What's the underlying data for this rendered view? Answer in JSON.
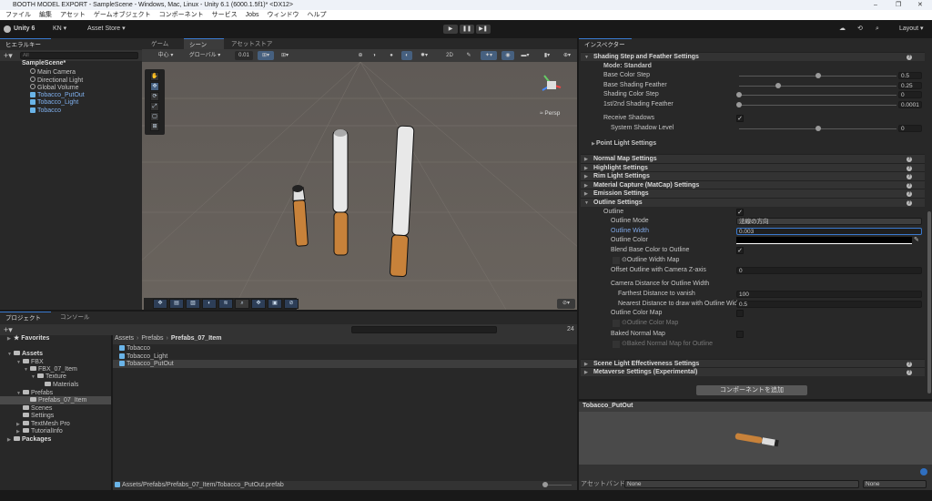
{
  "window": {
    "title": "BOOTH MODEL EXPORT - SampleScene - Windows, Mac, Linux - Unity 6.1 (6000.1.5f1)* <DX12>",
    "minimize": "–",
    "maximize": "❐",
    "close": "✕"
  },
  "menu": [
    "ファイル",
    "編集",
    "アセット",
    "ゲームオブジェクト",
    "コンポーネント",
    "サービス",
    "Jobs",
    "ウィンドウ",
    "ヘルプ"
  ],
  "toolbar": {
    "unity": "Unity 6",
    "account": "KN ▾",
    "asset_store": "Asset Store ▾",
    "play": "▶",
    "pause": "❚❚",
    "step": "▶❚",
    "layout": "Layout ▾"
  },
  "hierarchy": {
    "tab": "ヒエラルキー",
    "search_placeholder": "All",
    "scene": "SampleScene*",
    "items": [
      {
        "label": "Main Camera",
        "prefab": false
      },
      {
        "label": "Directional Light",
        "prefab": false
      },
      {
        "label": "Global Volume",
        "prefab": false
      },
      {
        "label": "Tobacco_PutOut",
        "prefab": true
      },
      {
        "label": "Tobacco_Light",
        "prefab": true
      },
      {
        "label": "Tobacco",
        "prefab": true
      }
    ]
  },
  "scene_tabs": [
    "ゲーム",
    "シーン",
    "アセットストア"
  ],
  "scene_toolbar": {
    "pivot": "中心 ▾",
    "space": "グローバル ▾",
    "snap": "0.01",
    "mode_2d": "2D"
  },
  "scene_view": {
    "persp": "≈ Persp",
    "colors": {
      "ground": "#615b56",
      "filter": "#c8823a",
      "paper": "#e8e8e8"
    }
  },
  "inspector": {
    "tab": "インスペクター",
    "rows": [
      {
        "type": "header",
        "label": "Shading Step and Feather Settings",
        "expanded": true
      },
      {
        "type": "label",
        "label": "Mode: Standard"
      },
      {
        "type": "slider",
        "label": "Base Color Step",
        "value": "0.5",
        "fraction": 0.5
      },
      {
        "type": "slider",
        "label": "Base Shading Feather",
        "value": "0.25",
        "fraction": 0.25
      },
      {
        "type": "slider",
        "label": "Shading Color Step",
        "value": "0",
        "fraction": 0
      },
      {
        "type": "slider",
        "label": "1st/2nd Shading Feather",
        "value": "0.0001",
        "fraction": 0
      },
      {
        "type": "check",
        "label": "Receive Shadows",
        "checked": true
      },
      {
        "type": "slider",
        "label": "System Shadow Level",
        "value": "0",
        "fraction": 0.5
      },
      {
        "type": "sub",
        "label": "Point Light Settings"
      },
      {
        "type": "header",
        "label": "Normal Map Settings"
      },
      {
        "type": "header",
        "label": "Highlight Settings"
      },
      {
        "type": "header",
        "label": "Rim Light Settings"
      },
      {
        "type": "header",
        "label": "Material Capture (MatCap) Settings"
      },
      {
        "type": "header",
        "label": "Emission Settings"
      },
      {
        "type": "header",
        "label": "Outline Settings",
        "expanded": true
      },
      {
        "type": "check",
        "label": "Outline",
        "checked": true
      },
      {
        "type": "dropdown",
        "label": "Outline Mode",
        "value": "法線の方向"
      },
      {
        "type": "text",
        "label": "Outline Width",
        "value": "0.003",
        "focused": true
      },
      {
        "type": "color",
        "label": "Outline Color",
        "value": "#000000"
      },
      {
        "type": "check",
        "label": "Blend Base Color to Outline",
        "checked": true
      },
      {
        "type": "texture",
        "label": "⊙Outline Width Map"
      },
      {
        "type": "text",
        "label": "Offset Outline with Camera Z-axis",
        "value": "0"
      },
      {
        "type": "label2",
        "label": "Camera Distance for Outline Width"
      },
      {
        "type": "text",
        "label": "Farthest Distance to vanish",
        "value": "100"
      },
      {
        "type": "text",
        "label": "Nearest Distance to draw with Outline Widt",
        "value": "0.5"
      },
      {
        "type": "check",
        "label": "Outline Color Map",
        "checked": false
      },
      {
        "type": "texture",
        "label": "⊙Outline Color Map",
        "dim": true
      },
      {
        "type": "check",
        "label": "Baked Normal Map",
        "checked": false
      },
      {
        "type": "texture",
        "label": "⊙Baked Normal Map for Outline",
        "dim": true
      },
      {
        "type": "header",
        "label": "Scene Light Effectiveness Settings"
      },
      {
        "type": "header",
        "label": "Metaverse Settings (Experimental)"
      }
    ],
    "add_component": "コンポーネントを追加",
    "preview_title": "Tobacco_PutOut",
    "bundle_label": "アセットバンドル",
    "bundle_value": "None",
    "bundle_variant": "None"
  },
  "project": {
    "tabs": [
      "プロジェクト",
      "コンソール"
    ],
    "tree": [
      "Favorites",
      "Assets",
      "FBX",
      "FBX_07_Item",
      "Texture",
      "Materials",
      "Prefabs",
      "Prefabs_07_Item",
      "Scenes",
      "Settings",
      "TextMesh Pro",
      "TutorialInfo",
      "Packages"
    ],
    "breadcrumb": [
      "Assets",
      "Prefabs",
      "Prefabs_07_Item"
    ],
    "items": [
      "Tobacco",
      "Tobacco_Light",
      "Tobacco_PutOut"
    ],
    "selected": "Tobacco_PutOut",
    "hidden_count": "24",
    "path": "Assets/Prefabs/Prefabs_07_Item/Tobacco_PutOut.prefab"
  }
}
